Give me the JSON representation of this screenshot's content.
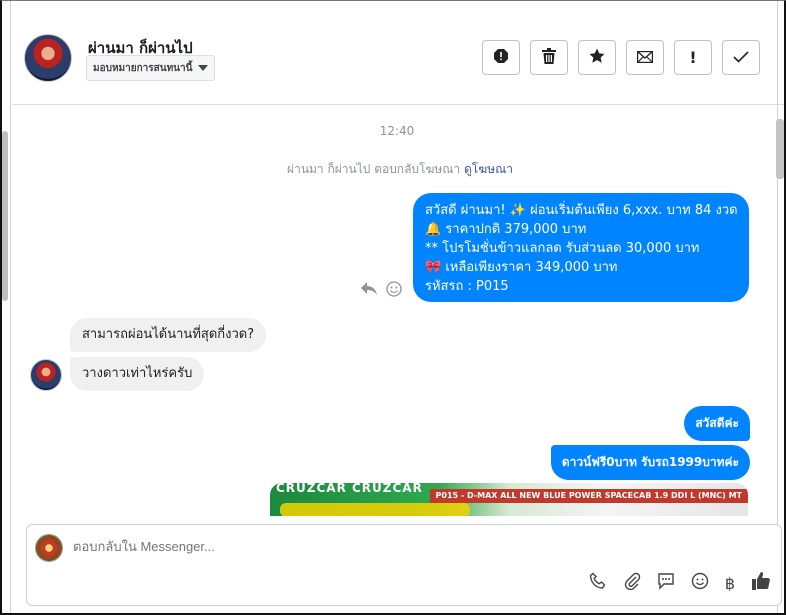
{
  "header": {
    "contact_name": "ผ่านมา ก็ผ่านไป",
    "assign_label": "มอบหมายการสนทนานี้",
    "actions": [
      {
        "name": "spam-alert-icon",
        "glyph": "●"
      },
      {
        "name": "trash-icon",
        "glyph": "🗑"
      },
      {
        "name": "star-icon",
        "glyph": "★"
      },
      {
        "name": "mail-icon",
        "glyph": "✉"
      },
      {
        "name": "exclamation-icon",
        "glyph": "!"
      },
      {
        "name": "check-icon",
        "glyph": "✓"
      }
    ]
  },
  "chat": {
    "time": "12:40",
    "reply_note": "ผ่านมา ก็ผ่านไป ตอบกลับโฆษณา",
    "reply_link": "ดูโฆษณา",
    "outgoing_long": [
      "สวัสดี ผ่านมา! ✨  ผ่อนเริ่มต้นเพียง 6,xxx. บาท 84 งวด",
      "🔔 ราคาปกติ 379,000 บาท",
      "** โปรโมชั่นข้าวแลกลด รับส่วนลด 30,000 บาท",
      "🎀  เหลือเพียงราคา 349,000 บาท",
      " รหัสรถ : P015"
    ],
    "incoming": [
      "สามารถผ่อนได้นานที่สุดกี่งวด?",
      "วางดาวเท่าไหร่ครับ"
    ],
    "outgoing_short": [
      "สวัสดีค่ะ",
      "ดาวน์ฟรี0บาท รับรถ1999บาทค่ะ"
    ],
    "image_banner": "P015 - D-MAX ALL NEW BLUE POWER SPACECAB 1.9 DDI L (MNC) MT",
    "image_text": "CRUZCAR CRUZCAR"
  },
  "composer": {
    "placeholder": "ตอบกลับใน Messenger..."
  },
  "colors": {
    "accent": "#0084ff",
    "incoming_bubble": "#f1f0f0"
  }
}
